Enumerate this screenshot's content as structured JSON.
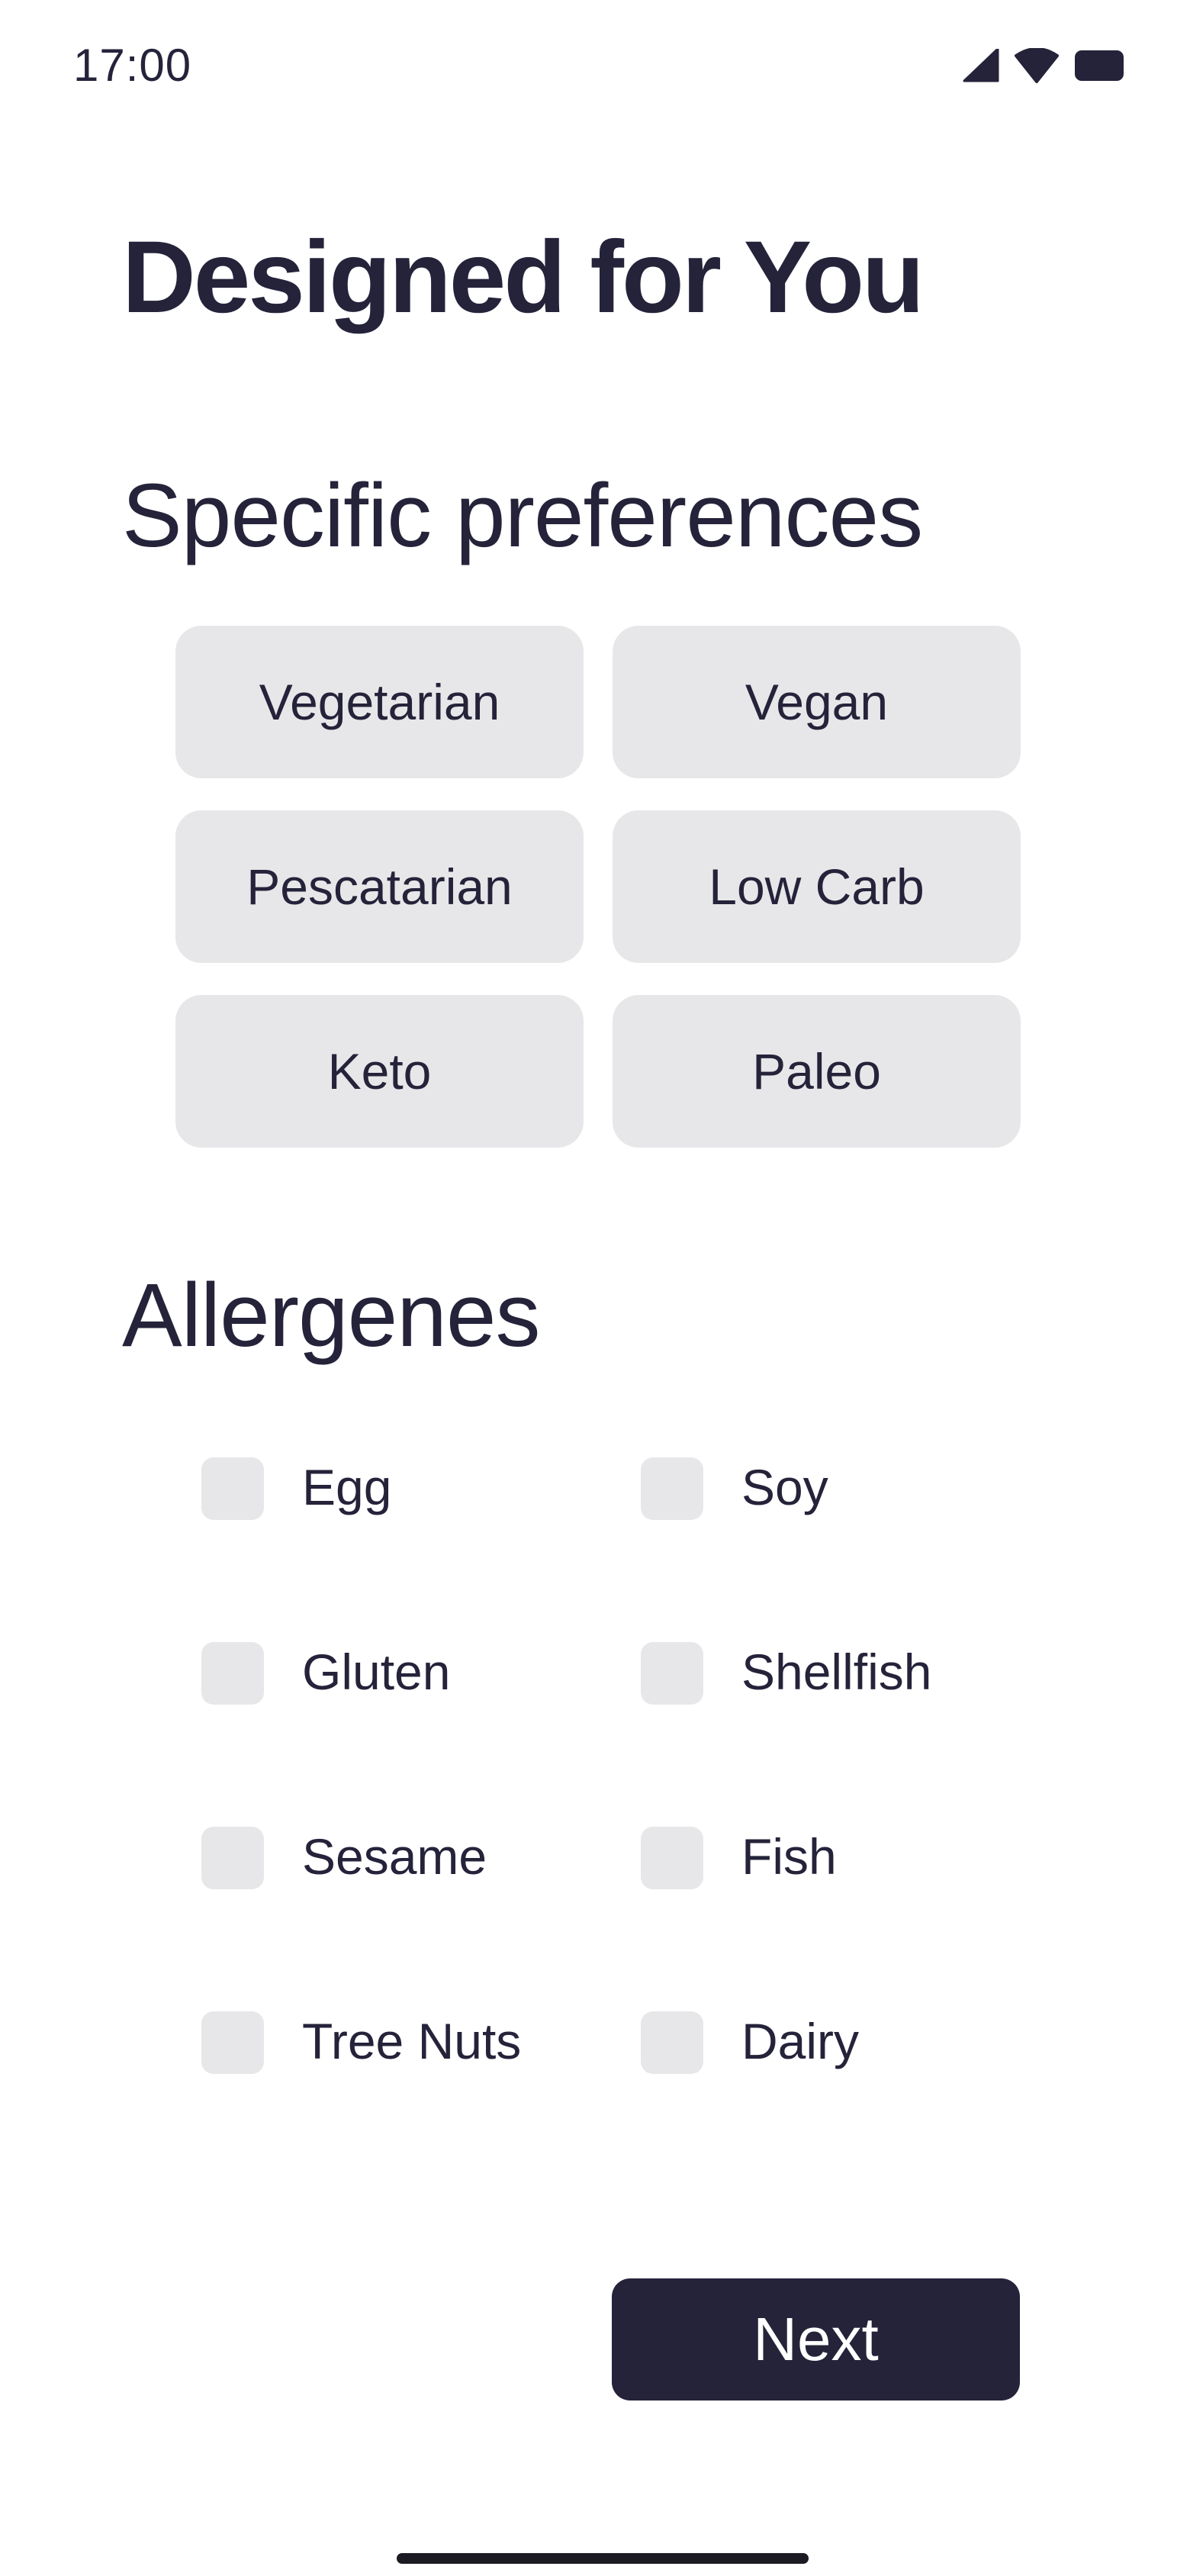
{
  "status_bar": {
    "time": "17:00",
    "icons": [
      "cellular-signal-icon",
      "wifi-icon",
      "battery-icon"
    ]
  },
  "page": {
    "title": "Designed for You"
  },
  "preferences": {
    "title": "Specific preferences",
    "options": [
      {
        "label": "Vegetarian",
        "selected": false
      },
      {
        "label": "Vegan",
        "selected": false
      },
      {
        "label": "Pescatarian",
        "selected": false
      },
      {
        "label": "Low Carb",
        "selected": false
      },
      {
        "label": "Keto",
        "selected": false
      },
      {
        "label": "Paleo",
        "selected": false
      }
    ]
  },
  "allergens": {
    "title": "Allergenes",
    "items": [
      {
        "label": "Egg",
        "checked": false
      },
      {
        "label": "Soy",
        "checked": false
      },
      {
        "label": "Gluten",
        "checked": false
      },
      {
        "label": "Shellfish",
        "checked": false
      },
      {
        "label": "Sesame",
        "checked": false
      },
      {
        "label": "Fish",
        "checked": false
      },
      {
        "label": "Tree Nuts",
        "checked": false
      },
      {
        "label": "Dairy",
        "checked": false
      }
    ]
  },
  "actions": {
    "next_label": "Next"
  },
  "colors": {
    "text": "#25233a",
    "chip_bg": "#e7e7e9",
    "button_bg": "#25233a",
    "button_text": "#ffffff",
    "background": "#ffffff"
  }
}
